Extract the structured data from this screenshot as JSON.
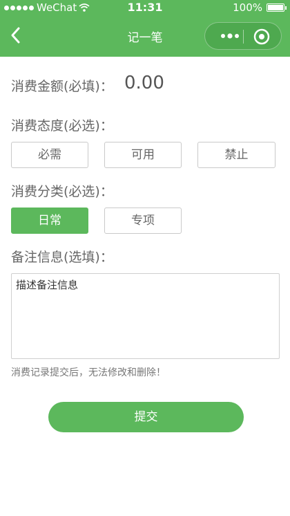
{
  "status_bar": {
    "carrier": "WeChat",
    "time": "11:31",
    "battery": "100%"
  },
  "nav": {
    "title": "记一笔",
    "back_icon": "chevron-left-icon",
    "more_icon": "more-dots-icon",
    "close_icon": "target-close-icon"
  },
  "amount": {
    "label": "消费金额(必填)：",
    "value": "0.00"
  },
  "attitude": {
    "label": "消费态度(必选)：",
    "options": [
      "必需",
      "可用",
      "禁止"
    ]
  },
  "category": {
    "label": "消费分类(必选)：",
    "options": [
      "日常",
      "专项"
    ],
    "selected": "日常"
  },
  "remark": {
    "label": "备注信息(选填)：",
    "placeholder": "描述备注信息"
  },
  "notice": "消费记录提交后，无法修改和删除！",
  "submit_label": "提交",
  "colors": {
    "primary": "#5cb85c",
    "border": "#c9c9c9",
    "text": "#666666"
  }
}
